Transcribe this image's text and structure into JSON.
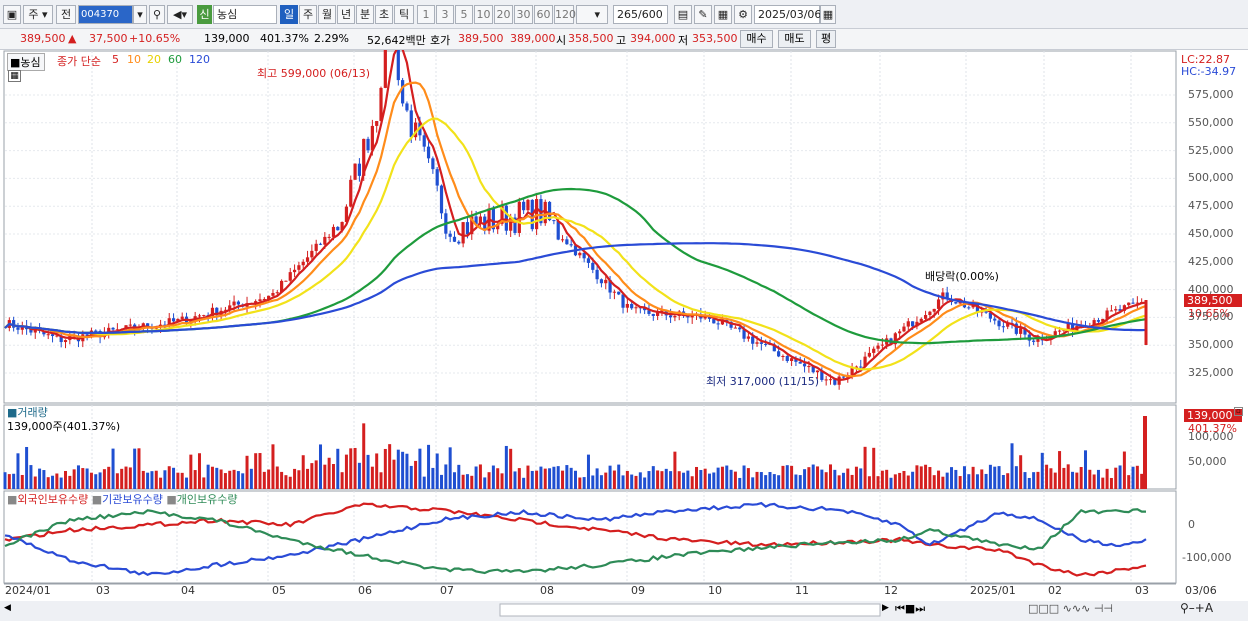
{
  "toolbar": {
    "period_jo": "주",
    "jeon": "전",
    "stock_code": "004370",
    "sin_badge": "신",
    "stock_name": "농심",
    "periods": [
      "일",
      "주",
      "월",
      "년",
      "분",
      "초",
      "틱"
    ],
    "minutes": [
      "1",
      "3",
      "5",
      "10",
      "20",
      "30",
      "60",
      "120"
    ],
    "count": "265",
    "count_max": "/600",
    "date": "2025/03/06"
  },
  "quote": {
    "price": "389,500",
    "change": "37,500",
    "change_pct": "+10.65%",
    "volume": "139,000",
    "volume_ratio": "401.37%",
    "turnover": "2.29%",
    "amount": "52,642백만",
    "bid_label": "호가",
    "bid": "389,500",
    "ask": "389,000",
    "open_label": "시",
    "open": "358,500",
    "high_label": "고",
    "high": "394,000",
    "low_label": "저",
    "low": "353,500",
    "buy_label": "매수",
    "sell_label": "매도",
    "avg_label": "평"
  },
  "legend": {
    "stock": "농심",
    "ma_title": "종가 단순",
    "ma_periods": [
      "5",
      "10",
      "20",
      "60",
      "120"
    ],
    "ma_colors": [
      "#d41f1f",
      "#ff8c1a",
      "#f2e21a",
      "#1e9b3c",
      "#2a4bd6"
    ]
  },
  "annotations": {
    "high": "최고 599,000 (06/13)",
    "low": "최저 317,000 (11/15)",
    "dividend": "배당락(0.00%)"
  },
  "lc_label": "LC:22.87",
  "hc_label": "HC:-34.97",
  "current_price_tag": "389,500",
  "current_pct_tag": "10.65%",
  "volume_panel": {
    "title": "거래량",
    "value": "139,000주(401.37%)",
    "tag": "139,000",
    "tag_pct": "401.37%"
  },
  "holding_panel": {
    "legend": [
      "외국인보유수량",
      "기관보유수량",
      "개인보유수량"
    ],
    "colors": [
      "#d41f1f",
      "#2a4bd6",
      "#2e8b57"
    ]
  },
  "x_labels": [
    "2024/01",
    "03",
    "04",
    "05",
    "06",
    "07",
    "08",
    "09",
    "10",
    "11",
    "12",
    "2025/01",
    "02",
    "03",
    "03/06"
  ],
  "price_axis": [
    "575,000",
    "550,000",
    "525,000",
    "500,000",
    "475,000",
    "450,000",
    "425,000",
    "400,000",
    "375,000",
    "350,000",
    "325,000"
  ],
  "volume_axis": [
    "100,000",
    "50,000"
  ],
  "holding_axis": [
    "0",
    "-100,000"
  ],
  "chart_data": {
    "type": "line",
    "title": "",
    "price_key_points": [
      {
        "x": "2024/01",
        "y": 370000
      },
      {
        "x": "02",
        "y": 355000
      },
      {
        "x": "03",
        "y": 360000
      },
      {
        "x": "04",
        "y": 372000
      },
      {
        "x": "05",
        "y": 395000
      },
      {
        "x": "06",
        "y": 460000
      },
      {
        "x": "06/13",
        "y": 599000
      },
      {
        "x": "07",
        "y": 455000
      },
      {
        "x": "08",
        "y": 470000
      },
      {
        "x": "09",
        "y": 380000
      },
      {
        "x": "10",
        "y": 375000
      },
      {
        "x": "11/15",
        "y": 317000
      },
      {
        "x": "12",
        "y": 350000
      },
      {
        "x": "2025/01",
        "y": 395000
      },
      {
        "x": "02",
        "y": 355000
      },
      {
        "x": "03/06",
        "y": 389500
      }
    ],
    "ylim": [
      300000,
      600000
    ]
  }
}
